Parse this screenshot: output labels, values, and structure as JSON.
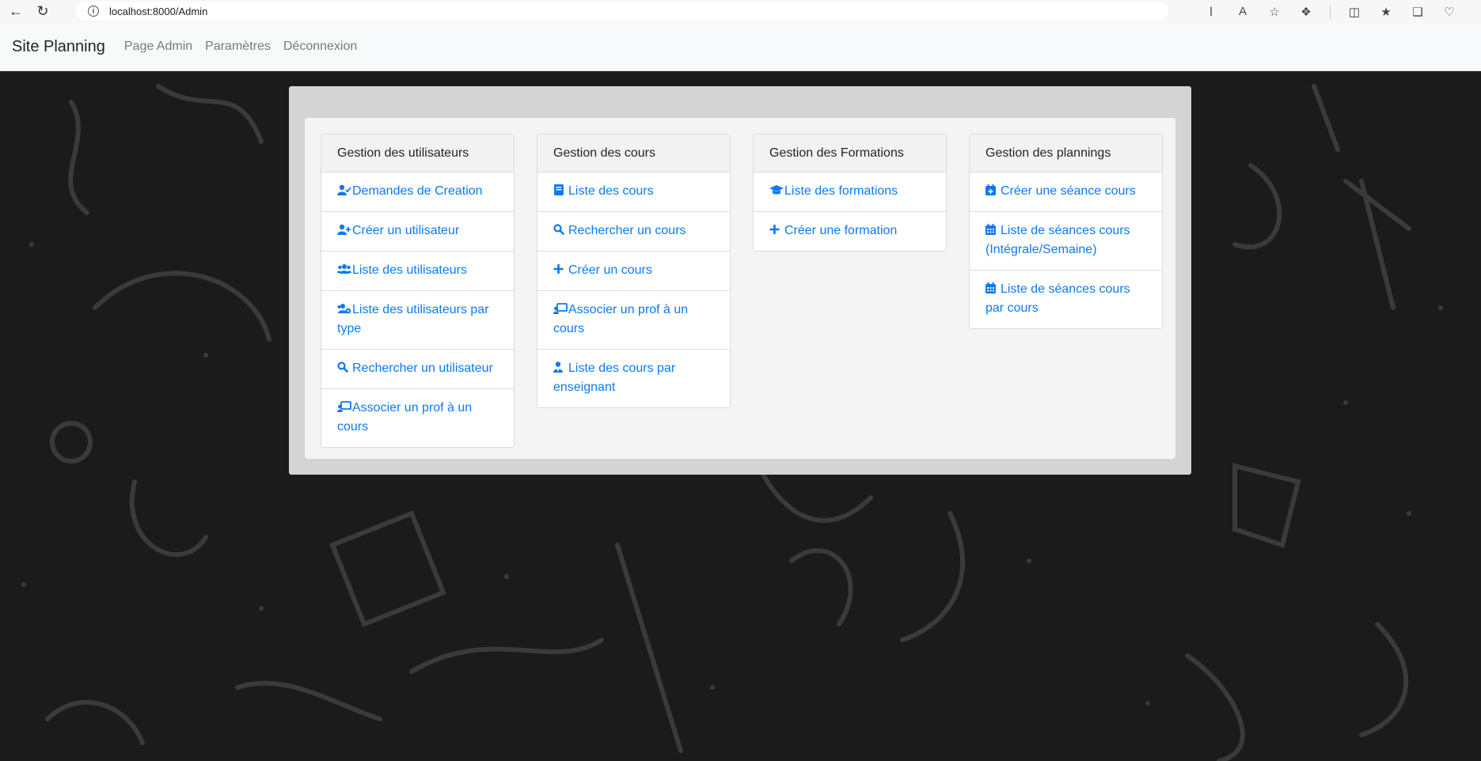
{
  "browser": {
    "url": "localhost:8000/Admin"
  },
  "navbar": {
    "brand": "Site Planning",
    "links": [
      "Page Admin",
      "Paramètres",
      "Déconnexion"
    ]
  },
  "cards": [
    {
      "title": "Gestion des utilisateurs",
      "items": [
        {
          "label": "Demandes de Creation",
          "icon": "user-check-icon"
        },
        {
          "label": "Créer un utilisateur",
          "icon": "user-plus-icon"
        },
        {
          "label": "Liste des utilisateurs",
          "icon": "users-icon"
        },
        {
          "label": "Liste des utilisateurs par type",
          "icon": "users-cog-icon"
        },
        {
          "label": "Rechercher un utilisateur",
          "icon": "search-icon"
        },
        {
          "label": "Associer un prof à un cours",
          "icon": "chalkboard-teacher-icon"
        }
      ]
    },
    {
      "title": "Gestion des cours",
      "items": [
        {
          "label": "Liste des cours",
          "icon": "book-icon"
        },
        {
          "label": "Rechercher un cours",
          "icon": "search-icon"
        },
        {
          "label": "Créer un cours",
          "icon": "plus-icon"
        },
        {
          "label": "Associer un prof à un cours",
          "icon": "chalkboard-teacher-icon"
        },
        {
          "label": "Liste des cours par enseignant",
          "icon": "user-tie-icon"
        }
      ]
    },
    {
      "title": "Gestion des Formations",
      "items": [
        {
          "label": "Liste des formations",
          "icon": "graduation-cap-icon"
        },
        {
          "label": "Créer une formation",
          "icon": "plus-icon"
        }
      ]
    },
    {
      "title": "Gestion des plannings",
      "items": [
        {
          "label": "Créer une séance cours",
          "icon": "calendar-plus-icon"
        },
        {
          "label": "Liste de séances cours (Intégrale/Semaine)",
          "icon": "calendar-icon"
        },
        {
          "label": "Liste de séances cours par cours",
          "icon": "calendar-icon"
        }
      ]
    }
  ],
  "colors": {
    "link": "#0d79f2",
    "background": "#1b1b1b",
    "panel_outer": "#d4d4d4",
    "panel_inner": "#f4f4f4"
  }
}
